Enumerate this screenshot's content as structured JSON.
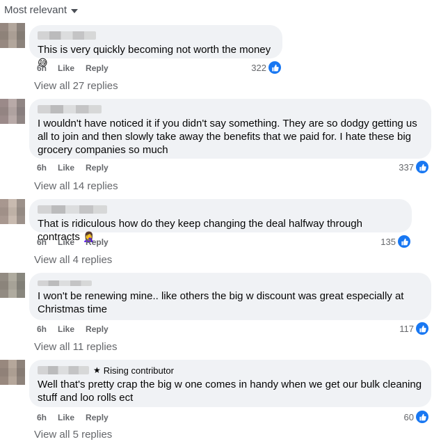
{
  "sort": {
    "label": "Most relevant"
  },
  "comments": [
    {
      "text": "This is very quickly becoming not worth the money",
      "emoji": "😅",
      "time": "6h",
      "like": "Like",
      "reply": "Reply",
      "count": "322",
      "replies": "View all 27 replies"
    },
    {
      "text": "I wouldn't have noticed it if you didn't say something. They are so dodgy getting us all to join and then slowly take away the benefits that we paid for. I hate these big grocery companies so much",
      "time": "6h",
      "like": "Like",
      "reply": "Reply",
      "count": "337",
      "replies": "View all 14 replies"
    },
    {
      "text": "That is ridiculous how do they keep changing the deal halfway through contracts",
      "emoji": "🤦‍♀️",
      "time": "6h",
      "like": "Like",
      "reply": "Reply",
      "count": "135",
      "replies": "View all 4 replies"
    },
    {
      "text": "I won't be renewing mine.. like others the big w discount was great especially at Christmas time",
      "time": "6h",
      "like": "Like",
      "reply": "Reply",
      "count": "117",
      "replies": "View all 11 replies"
    },
    {
      "badge": "Rising contributor",
      "text": "Well that's pretty crap the big w one comes in handy when we get our bulk cleaning stuff and loo rolls ect",
      "time": "6h",
      "like": "Like",
      "reply": "Reply",
      "count": "60",
      "replies": "View all 5 replies"
    }
  ],
  "colors": {
    "like_blue": "#1877f2",
    "bubble": "#f0f2f5",
    "meta": "#65676b"
  }
}
